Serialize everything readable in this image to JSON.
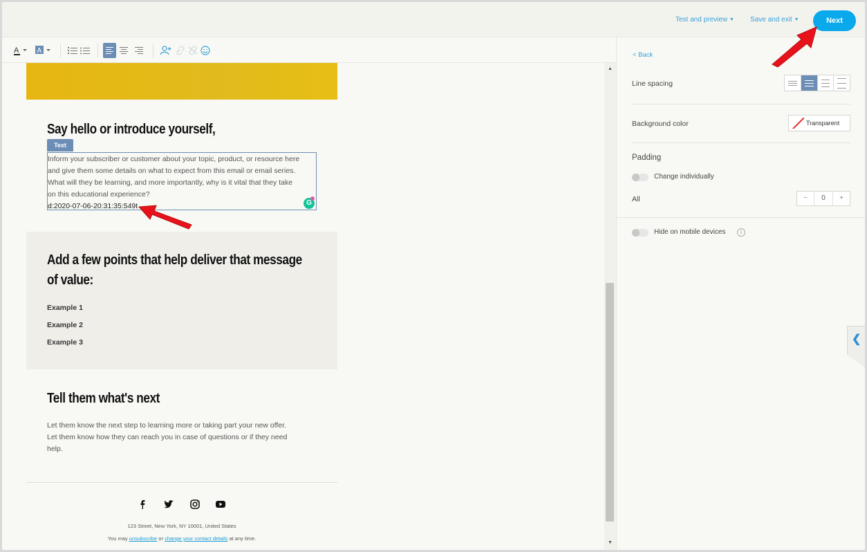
{
  "topbar": {
    "test_preview": "Test and preview",
    "save_exit": "Save and exit",
    "next": "Next"
  },
  "toolbar": {
    "icons": [
      "text-color-icon",
      "highlight-color-icon",
      "ordered-list-icon",
      "unordered-list-icon",
      "align-left-icon",
      "align-center-icon",
      "align-right-icon",
      "insert-personalization-icon",
      "insert-link-icon",
      "remove-link-icon",
      "emoji-icon"
    ]
  },
  "email": {
    "section1_heading": "Say hello or introduce yourself,",
    "text_tag": "Text",
    "body_lines": [
      "Inform your subscriber or customer about your topic, product, or resource here",
      "and give them some details on what to expect from this email or email series.",
      "What will they be learning, and more importantly, why is it vital that they take",
      "on this educational experience?"
    ],
    "meta_line": "d:2020-07-06-20:31:35:549t",
    "section2_heading_line1": "Add a few points that help deliver that message",
    "section2_heading_line2": "of value:",
    "examples": [
      "Example 1",
      "Example 2",
      "Example 3"
    ],
    "section3_heading": "Tell them what's next",
    "section3_lines": [
      "Let them know the next step to learning more or taking part your new offer.",
      "Let them know how they can reach you in case of questions or if they need",
      "help."
    ],
    "social": {
      "facebook": "f",
      "twitter": "t",
      "instagram": "◎",
      "youtube": "▶"
    },
    "address": "123 Street, New York, NY 10001, United States",
    "footer_prefix": "You may",
    "unsubscribe": "unsubscribe",
    "footer_or": "or",
    "change_details": "change your contact details",
    "footer_suffix": "at any time."
  },
  "panel": {
    "back": "< Back",
    "line_spacing": "Line spacing",
    "background_color": "Background color",
    "transparent": "Transparent",
    "padding": "Padding",
    "change_individually": "Change individually",
    "all": "All",
    "padding_value": "0",
    "minus": "−",
    "plus": "+",
    "hide_mobile": "Hide on mobile devices",
    "info": "i",
    "collapse": "❮"
  },
  "colors": {
    "accent": "#0aa9ec",
    "link": "#3aa0d8",
    "selection": "#6c8db5",
    "annotation_arrow": "#e8121b"
  }
}
